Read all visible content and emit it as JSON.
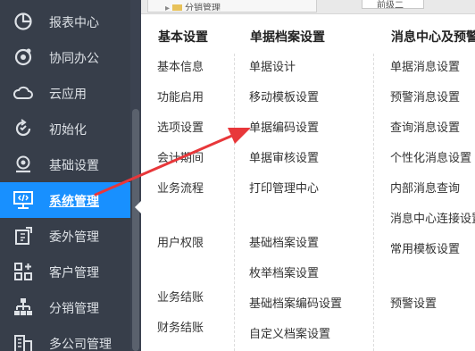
{
  "sidebar": {
    "items": [
      {
        "label": "报表中心",
        "icon": "report-icon",
        "active": false
      },
      {
        "label": "协同办公",
        "icon": "collaboration-icon",
        "active": false
      },
      {
        "label": "云应用",
        "icon": "cloud-icon",
        "active": false
      },
      {
        "label": "初始化",
        "icon": "initialize-icon",
        "active": false
      },
      {
        "label": "基础设置",
        "icon": "settings-icon",
        "active": false
      },
      {
        "label": "系统管理",
        "icon": "system-management-icon",
        "active": true
      },
      {
        "label": "委外管理",
        "icon": "outsourcing-icon",
        "active": false
      },
      {
        "label": "客户管理",
        "icon": "customer-icon",
        "active": false
      },
      {
        "label": "分销管理",
        "icon": "distribution-icon",
        "active": false
      },
      {
        "label": "多公司管理",
        "icon": "multi-company-icon",
        "active": false
      }
    ]
  },
  "topbar": {
    "tree_text": "分销管理",
    "input_text": "前级二"
  },
  "menu": {
    "columns": [
      {
        "header": "基本设置",
        "items": [
          "基本信息",
          "功能启用",
          "选项设置",
          "会计期间",
          "业务流程",
          "用户权限",
          "业务结账",
          "财务结账"
        ]
      },
      {
        "header": "单据档案设置",
        "items": [
          "单据设计",
          "移动模板设置",
          "单据编码设置",
          "单据审核设置",
          "打印管理中心",
          "基础档案设置",
          "枚举档案设置",
          "基础档案编码设置",
          "自定义档案设置"
        ]
      },
      {
        "header": "消息中心及预警",
        "items": [
          "单据消息设置",
          "预警消息设置",
          "查询消息设置",
          "个性化消息设置",
          "内部消息查询",
          "消息中心连接设置",
          "常用模板设置",
          "预警设置"
        ]
      }
    ]
  },
  "annotation": {
    "arrow_color": "#e8373a"
  }
}
